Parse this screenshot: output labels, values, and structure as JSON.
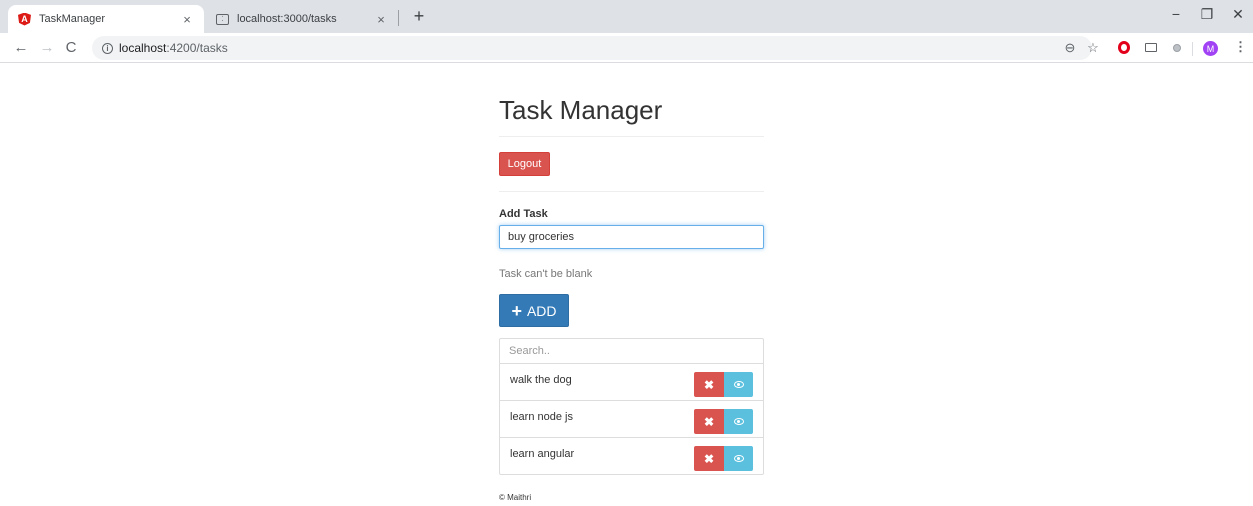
{
  "browser": {
    "tabs": [
      {
        "title": "TaskManager",
        "icon": "angular-icon",
        "active": true
      },
      {
        "title": "localhost:3000/tasks",
        "icon": "site-icon",
        "active": false
      }
    ],
    "tab_close_glyph": "×",
    "new_tab_glyph": "+",
    "window_controls": {
      "minimize": "−",
      "maximize": "❐",
      "close": "✕"
    },
    "nav": {
      "back": "←",
      "forward": "→",
      "reload": "C"
    },
    "address": {
      "host": "localhost",
      "path": ":4200/tasks"
    },
    "toolbar_icons": {
      "zoom": "⊖",
      "bookmark": "☆",
      "avatar_letter": "M",
      "menu": "⋮"
    }
  },
  "page": {
    "title": "Task Manager",
    "logout_label": "Logout",
    "add_task_label": "Add Task",
    "task_input_value": "buy groceries",
    "error_message": "Task can't be blank",
    "add_button_label": "ADD",
    "search_placeholder": "Search..",
    "tasks": [
      {
        "text": "walk the dog"
      },
      {
        "text": "learn node js"
      },
      {
        "text": "learn angular"
      }
    ],
    "delete_glyph": "✖",
    "footer": "© Maithri"
  },
  "colors": {
    "danger": "#d9534f",
    "primary": "#337ab7",
    "info": "#5bc0de",
    "input_focus": "#66afe9"
  }
}
